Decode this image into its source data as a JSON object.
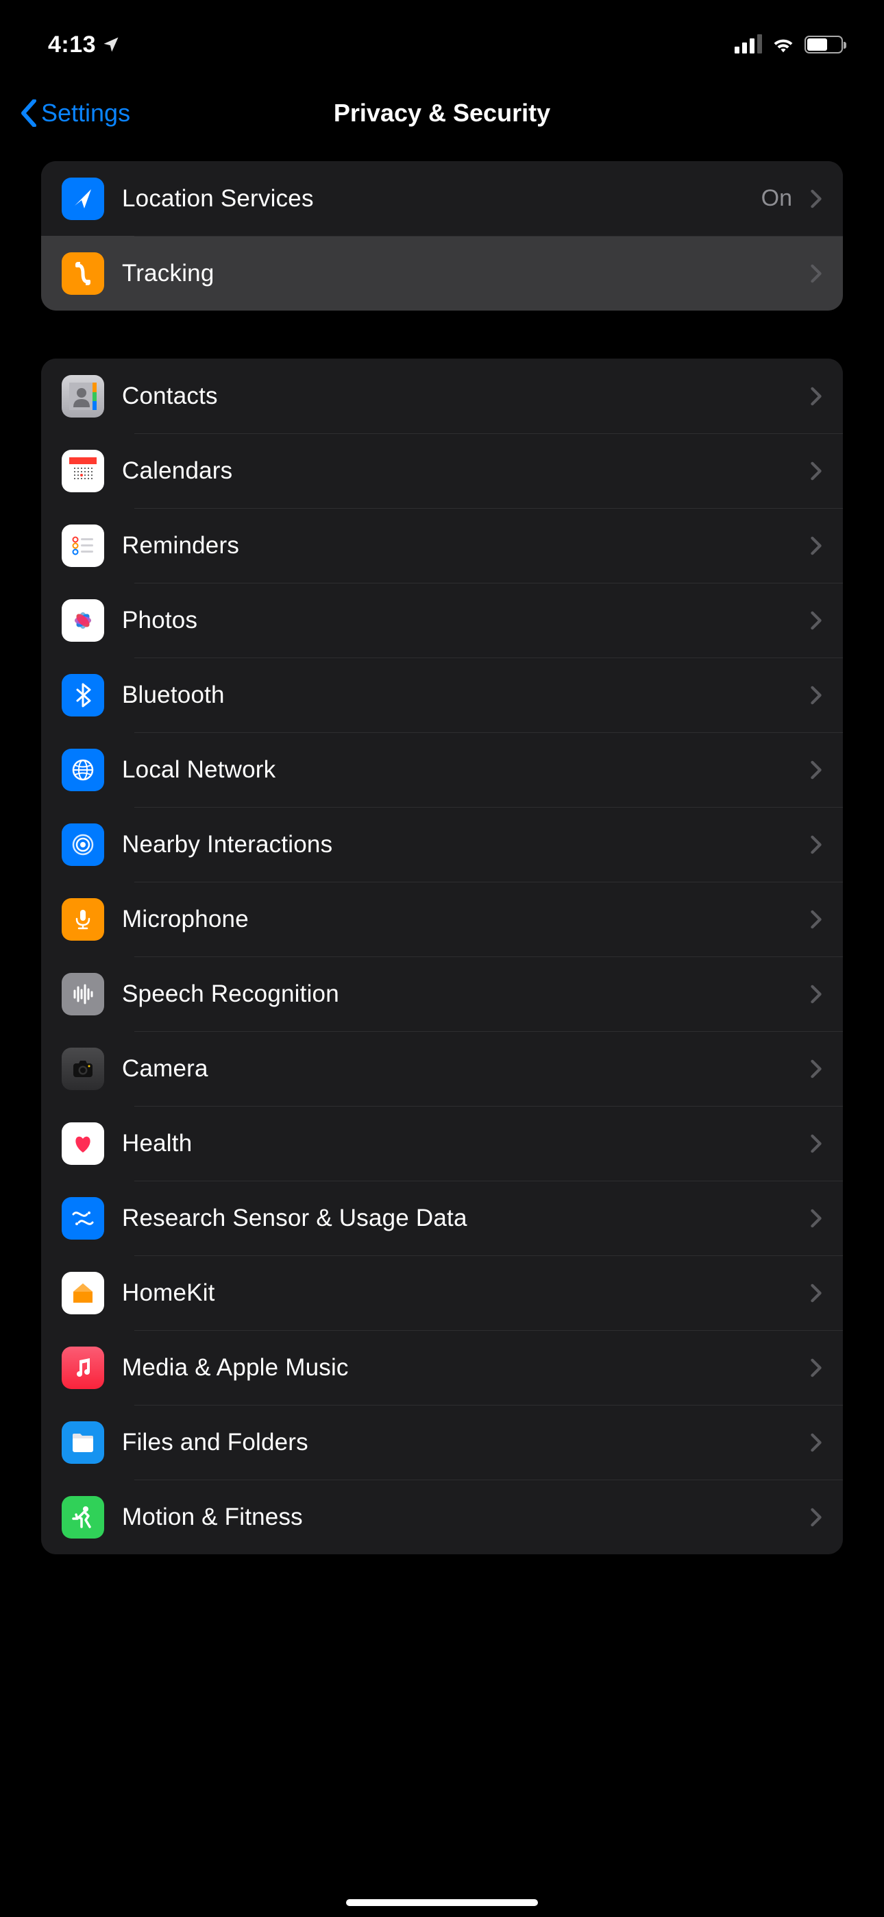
{
  "status": {
    "time": "4:13"
  },
  "nav": {
    "back": "Settings",
    "title": "Privacy & Security"
  },
  "group1": [
    {
      "label": "Location Services",
      "detail": "On",
      "icon": "location-arrow",
      "bg": "bg-blue",
      "hl": false
    },
    {
      "label": "Tracking",
      "detail": "",
      "icon": "tracking",
      "bg": "bg-orange",
      "hl": true
    }
  ],
  "group2": [
    {
      "label": "Contacts",
      "icon": "contacts",
      "bg": "bg-contacts"
    },
    {
      "label": "Calendars",
      "icon": "calendar",
      "bg": "bg-white"
    },
    {
      "label": "Reminders",
      "icon": "reminders",
      "bg": "bg-white"
    },
    {
      "label": "Photos",
      "icon": "photos",
      "bg": "bg-white"
    },
    {
      "label": "Bluetooth",
      "icon": "bluetooth",
      "bg": "bg-blue"
    },
    {
      "label": "Local Network",
      "icon": "globe",
      "bg": "bg-blue"
    },
    {
      "label": "Nearby Interactions",
      "icon": "nearby",
      "bg": "bg-blue"
    },
    {
      "label": "Microphone",
      "icon": "mic",
      "bg": "bg-orange"
    },
    {
      "label": "Speech Recognition",
      "icon": "waveform",
      "bg": "bg-gray"
    },
    {
      "label": "Camera",
      "icon": "camera",
      "bg": "bg-camera"
    },
    {
      "label": "Health",
      "icon": "heart",
      "bg": "bg-white"
    },
    {
      "label": "Research Sensor & Usage Data",
      "icon": "research",
      "bg": "bg-blue"
    },
    {
      "label": "HomeKit",
      "icon": "home",
      "bg": "bg-white"
    },
    {
      "label": "Media & Apple Music",
      "icon": "music",
      "bg": "bg-music-grad"
    },
    {
      "label": "Files and Folders",
      "icon": "folder",
      "bg": "bg-yellow-folder"
    },
    {
      "label": "Motion & Fitness",
      "icon": "fitness",
      "bg": "bg-green"
    }
  ]
}
